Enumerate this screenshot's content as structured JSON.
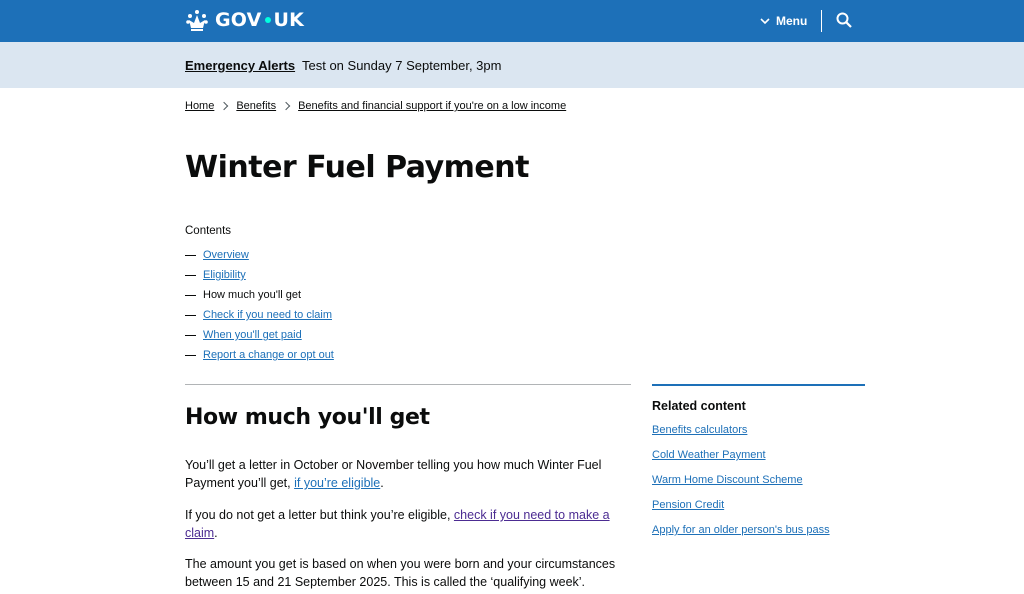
{
  "header": {
    "logo_text_left": "GOV",
    "logo_text_right": "UK",
    "menu_label": "Menu",
    "brand_color": "#1d70b8",
    "search_icon": "search-icon"
  },
  "alert": {
    "link_label": "Emergency Alerts",
    "text": "Test on Sunday 7 September, 3pm"
  },
  "breadcrumbs": [
    "Home",
    "Benefits",
    "Benefits and financial support if you're on a low income"
  ],
  "page_title": "Winter Fuel Payment",
  "contents": {
    "heading": "Contents",
    "items": [
      "Overview",
      "Eligibility",
      "How much you'll get",
      "Check if you need to claim",
      "When you'll get paid",
      "Report a change or opt out"
    ],
    "current_index": 2
  },
  "main": {
    "section_title": "How much you'll get",
    "p1_text": "You’ll get a letter in October or November telling you how much Winter Fuel Payment you’ll get, ",
    "p1_link": "if you’re eligible",
    "p1_end": ".",
    "p2_text": "If you do not get a letter but think you’re eligible, ",
    "p2_link": "check if you need to make a claim",
    "p2_end": ".",
    "p3_text": "The amount you get is based on when you were born and your circumstances between 15 and 21 September 2025. This is called the ‘qualifying week’."
  },
  "related": {
    "heading": "Related content",
    "items": [
      "Benefits calculators",
      "Cold Weather Payment",
      "Warm Home Discount Scheme",
      "Pension Credit",
      "Apply for an older person's bus pass"
    ]
  }
}
